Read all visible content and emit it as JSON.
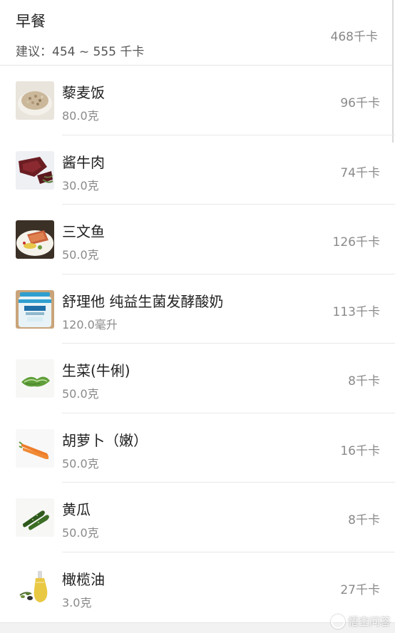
{
  "meal": {
    "title": "早餐",
    "suggestion": "建议：454 ~ 555 千卡",
    "total_kcal": "468千卡"
  },
  "items": [
    {
      "name": "藜麦饭",
      "amount": "80.0克",
      "kcal": "96千卡",
      "icon": "quinoa-rice-icon"
    },
    {
      "name": "酱牛肉",
      "amount": "30.0克",
      "kcal": "74千卡",
      "icon": "braised-beef-icon"
    },
    {
      "name": "三文鱼",
      "amount": "50.0克",
      "kcal": "126千卡",
      "icon": "salmon-icon"
    },
    {
      "name": "舒理他 纯益生菌发酵酸奶",
      "amount": "120.0毫升",
      "kcal": "113千卡",
      "icon": "yogurt-icon"
    },
    {
      "name": "生菜(牛俐)",
      "amount": "50.0克",
      "kcal": "8千卡",
      "icon": "lettuce-icon"
    },
    {
      "name": "胡萝卜（嫩）",
      "amount": "50.0克",
      "kcal": "16千卡",
      "icon": "carrot-icon"
    },
    {
      "name": "黄瓜",
      "amount": "50.0克",
      "kcal": "8千卡",
      "icon": "cucumber-icon"
    },
    {
      "name": "橄榄油",
      "amount": "3.0克",
      "kcal": "27千卡",
      "icon": "olive-oil-icon"
    }
  ],
  "watermark": "悟空问答"
}
